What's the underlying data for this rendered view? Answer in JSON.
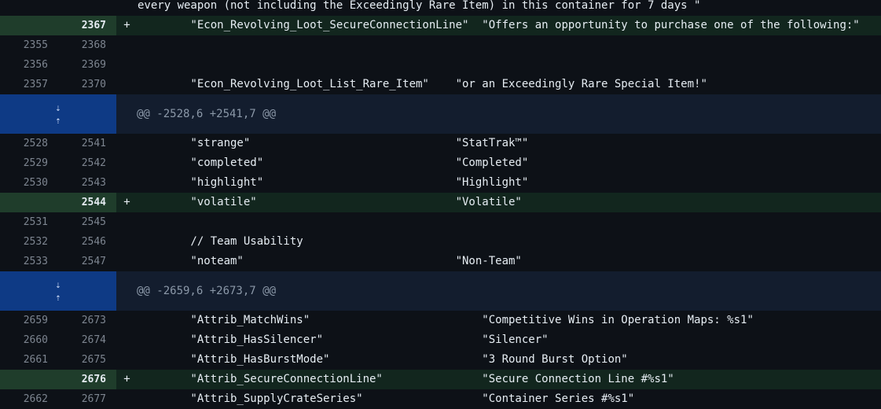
{
  "top_line": "every weapon (not including the Exceedingly Rare Item) in this container for 7 days \"",
  "rows_a": [
    {
      "type": "add",
      "old": "",
      "new": "2367",
      "sign": "+",
      "code": "        \"Econ_Revolving_Loot_SecureConnectionLine\"  \"Offers an opportunity to purchase one of the following:\""
    },
    {
      "type": "ctx",
      "old": "2355",
      "new": "2368",
      "sign": "",
      "code": ""
    },
    {
      "type": "ctx",
      "old": "2356",
      "new": "2369",
      "sign": "",
      "code": ""
    },
    {
      "type": "ctx",
      "old": "2357",
      "new": "2370",
      "sign": "",
      "code": "        \"Econ_Revolving_Loot_List_Rare_Item\"    \"or an Exceedingly Rare Special Item!\""
    }
  ],
  "hunk1": "@@ -2528,6 +2541,7 @@",
  "rows_b": [
    {
      "type": "ctx",
      "old": "2528",
      "new": "2541",
      "sign": "",
      "code": "        \"strange\"                               \"StatTrak™\""
    },
    {
      "type": "ctx",
      "old": "2529",
      "new": "2542",
      "sign": "",
      "code": "        \"completed\"                             \"Completed\""
    },
    {
      "type": "ctx",
      "old": "2530",
      "new": "2543",
      "sign": "",
      "code": "        \"highlight\"                             \"Highlight\""
    },
    {
      "type": "add",
      "old": "",
      "new": "2544",
      "sign": "+",
      "code": "        \"volatile\"                              \"Volatile\""
    },
    {
      "type": "ctx",
      "old": "2531",
      "new": "2545",
      "sign": "",
      "code": ""
    },
    {
      "type": "ctx",
      "old": "2532",
      "new": "2546",
      "sign": "",
      "code": "        // Team Usability"
    },
    {
      "type": "ctx",
      "old": "2533",
      "new": "2547",
      "sign": "",
      "code": "        \"noteam\"                                \"Non-Team\""
    }
  ],
  "hunk2": "@@ -2659,6 +2673,7 @@",
  "rows_c": [
    {
      "type": "ctx",
      "old": "2659",
      "new": "2673",
      "sign": "",
      "code": "        \"Attrib_MatchWins\"                          \"Competitive Wins in Operation Maps: %s1\""
    },
    {
      "type": "ctx",
      "old": "2660",
      "new": "2674",
      "sign": "",
      "code": "        \"Attrib_HasSilencer\"                        \"Silencer\""
    },
    {
      "type": "ctx",
      "old": "2661",
      "new": "2675",
      "sign": "",
      "code": "        \"Attrib_HasBurstMode\"                       \"3 Round Burst Option\""
    },
    {
      "type": "add",
      "old": "",
      "new": "2676",
      "sign": "+",
      "code": "        \"Attrib_SecureConnectionLine\"               \"Secure Connection Line #%s1\""
    },
    {
      "type": "ctx",
      "old": "2662",
      "new": "2677",
      "sign": "",
      "code": "        \"Attrib_SupplyCrateSeries\"                  \"Container Series #%s1\""
    }
  ],
  "icons": {
    "expand_down": "expand-down-icon",
    "expand_up": "expand-up-icon"
  }
}
